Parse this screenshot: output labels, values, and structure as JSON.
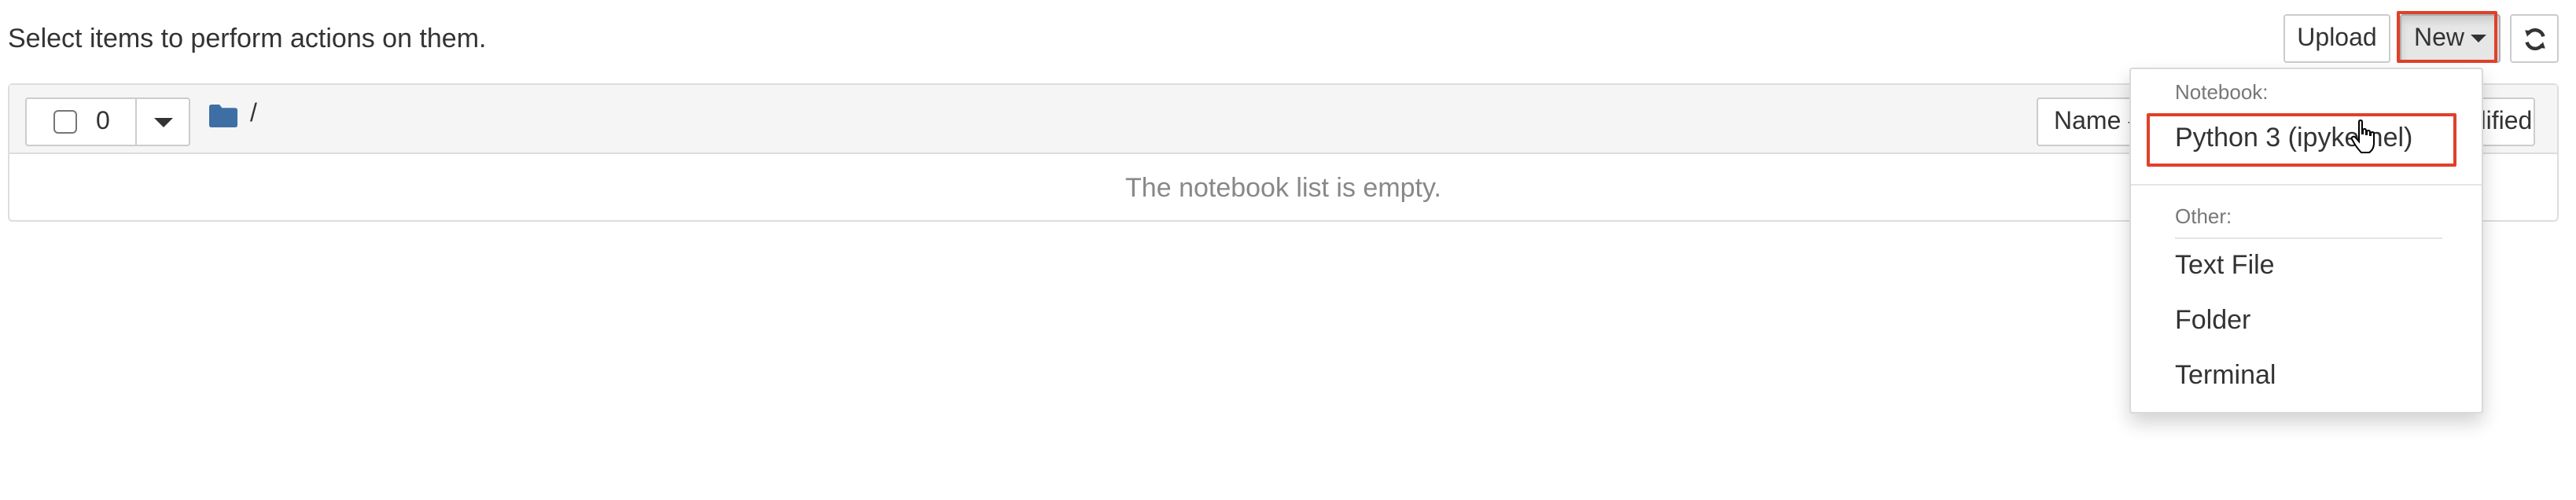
{
  "toolbar": {
    "instructions": "Select items to perform actions on them.",
    "upload_label": "Upload",
    "new_label": "New"
  },
  "list": {
    "selected_count": "0",
    "breadcrumb_separator": "/",
    "sort_name_label": "Name",
    "sort_last_modified_label": "Last Modified",
    "empty_message": "The notebook list is empty."
  },
  "new_menu": {
    "notebook_header": "Notebook:",
    "python_kernel": "Python 3 (ipykernel)",
    "other_header": "Other:",
    "text_file": "Text File",
    "folder": "Folder",
    "terminal": "Terminal"
  },
  "colors": {
    "highlight": "#e0402a",
    "folder_icon": "#3d6fa5",
    "empty_text": "#888888"
  },
  "icons": [
    "refresh-icon",
    "folder-icon",
    "sort-down-icon",
    "caret-down-icon",
    "hand-cursor-icon"
  ]
}
